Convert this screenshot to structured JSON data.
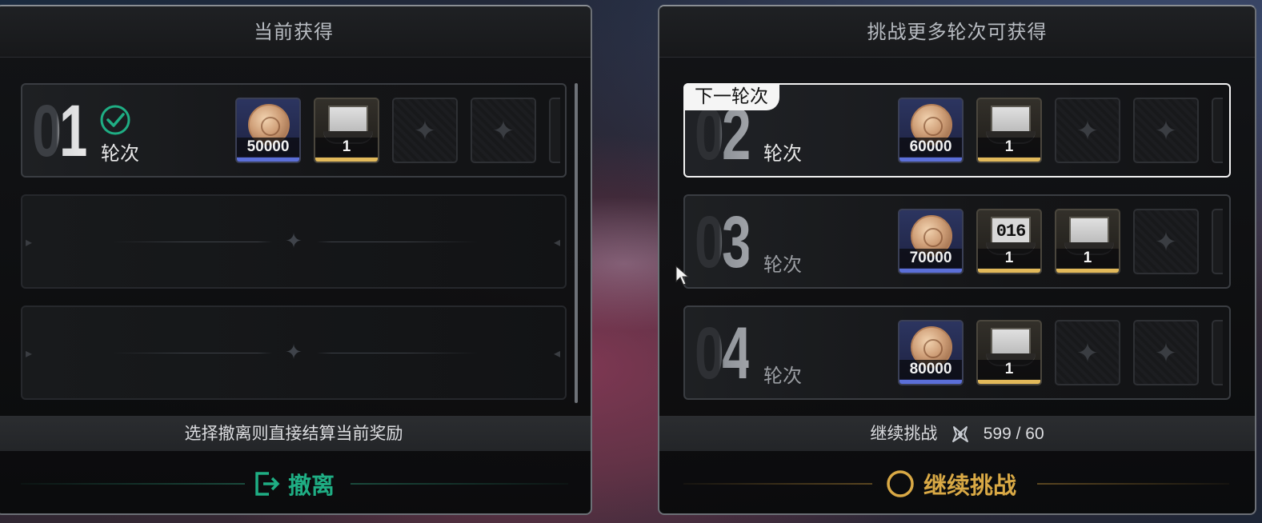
{
  "left_panel": {
    "title": "当前获得",
    "rounds": [
      {
        "number": "01",
        "label": "轮次",
        "completed": true,
        "rewards": [
          {
            "type": "coin",
            "icon": "coin-icon",
            "qty": "50000",
            "rarity_color": "#5b6fd8"
          },
          {
            "type": "card",
            "icon": "card-icon",
            "qty": "1",
            "rarity_color": "#e2b95a"
          }
        ]
      }
    ],
    "info_text": "选择撤离则直接结算当前奖励",
    "action_label": "撤离",
    "action_color": "#1fae84"
  },
  "right_panel": {
    "title": "挑战更多轮次可获得",
    "next_tag": "下一轮次",
    "rounds": [
      {
        "number": "02",
        "label": "轮次",
        "rewards": [
          {
            "type": "coin",
            "icon": "coin-icon",
            "qty": "60000"
          },
          {
            "type": "card",
            "icon": "card-icon",
            "qty": "1"
          }
        ]
      },
      {
        "number": "03",
        "label": "轮次",
        "rewards": [
          {
            "type": "coin",
            "icon": "coin-icon",
            "qty": "70000"
          },
          {
            "type": "card",
            "icon": "number-card-icon",
            "card_text": "016",
            "qty": "1"
          },
          {
            "type": "card",
            "icon": "card-icon",
            "qty": "1"
          }
        ]
      },
      {
        "number": "04",
        "label": "轮次",
        "rewards": [
          {
            "type": "coin",
            "icon": "coin-icon",
            "qty": "80000"
          },
          {
            "type": "card",
            "icon": "card-icon",
            "qty": "1"
          }
        ]
      }
    ],
    "info_text": "继续挑战",
    "stamina_icon": "stamina-icon",
    "stamina_value": "599 / 60",
    "action_label": "继续挑战",
    "action_color": "#d9a945"
  }
}
